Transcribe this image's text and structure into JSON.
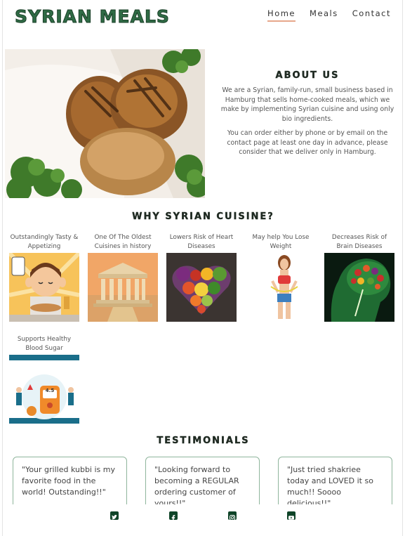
{
  "brand": "SYRIAN MEALS",
  "nav": [
    {
      "label": "Home",
      "active": true
    },
    {
      "label": "Meals",
      "active": false
    },
    {
      "label": "Contact",
      "active": false
    }
  ],
  "about": {
    "title": "ABOUT US",
    "paragraphs": [
      "We are a Syrian, family-run, small business based in Hamburg that sells home-cooked meals, which we make by implementing Syrian cuisine and using only bio ingredients.",
      "You can order either by phone or by email on the contact page at least one day in advance, please consider that we deliver only in Hamburg."
    ]
  },
  "why": {
    "title": "WHY SYRIAN CUISINE?",
    "items": [
      {
        "label": "Outstandingly Tasty & Appetizing"
      },
      {
        "label": "One Of The Oldest Cuisines in history"
      },
      {
        "label": "Lowers Risk of Heart Diseases"
      },
      {
        "label": "May help You Lose Weight"
      },
      {
        "label": "Decreases Risk of Brain Diseases"
      },
      {
        "label": "Supports Healthy Blood Sugar"
      }
    ],
    "glucose_reading": "4.5"
  },
  "testimonials": {
    "title": "TESTIMONIALS",
    "items": [
      {
        "text": "\"Your grilled kubbi is my favorite food in the world! Outstanding!!\""
      },
      {
        "text": "\"Looking forward to becoming a REGULAR ordering customer of yours!!\""
      },
      {
        "text": "\"Just tried shakriee today and LOVED it so much!! Soooo delicious!!\""
      }
    ]
  },
  "footer": {
    "icons": [
      "twitter-icon",
      "facebook-icon",
      "instagram-icon",
      "youtube-icon"
    ]
  },
  "colors": {
    "brand_green": "#2f6b45",
    "nav_underline": "#e7a78b",
    "card_border": "#8fb59c",
    "footer_icon": "#0f4428"
  }
}
